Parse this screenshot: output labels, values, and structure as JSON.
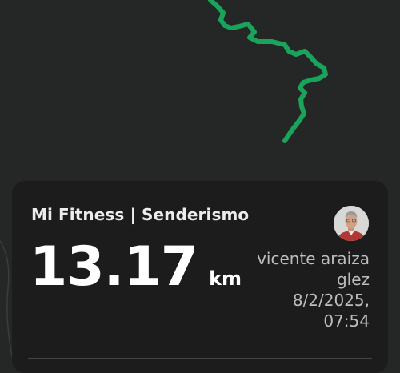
{
  "map": {
    "route_color": "#1aa35a"
  },
  "card": {
    "title": "Mi Fitness | Senderismo",
    "distance_value": "13.17",
    "distance_unit": "km",
    "user_name_line1": "vicente araiza",
    "user_name_line2": "glez",
    "date": "8/2/2025,",
    "time": "07:54"
  }
}
